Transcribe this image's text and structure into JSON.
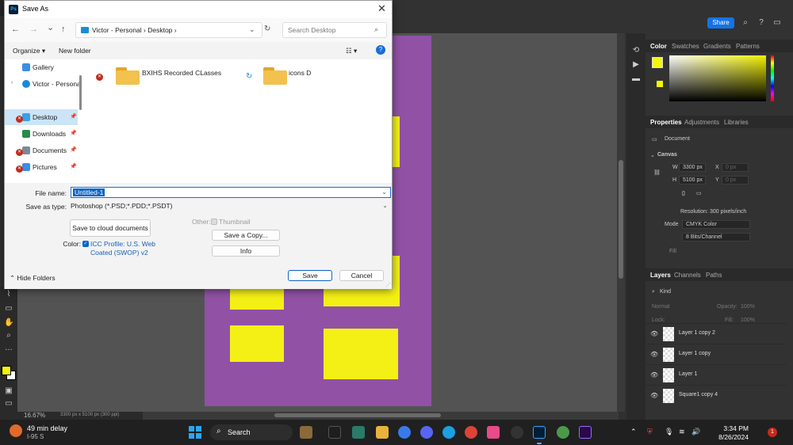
{
  "dialog": {
    "title": "Save As",
    "app_icon_text": "Ps",
    "close_glyph": "✕",
    "nav": {
      "back": "←",
      "forward": "→",
      "recent": "⌄",
      "up": "↑"
    },
    "address": {
      "path": "Victor - Personal  ›  Desktop  ›",
      "chevron": "⌄"
    },
    "refresh_glyph": "↻",
    "search": {
      "placeholder": "Search Desktop",
      "icon": "⌕"
    },
    "toolbar": {
      "organize": "Organize ▾",
      "new_folder": "New folder",
      "view_glyph": "☷ ▾",
      "help_glyph": "?"
    },
    "nav_pane": [
      {
        "label": "Gallery",
        "pinned": false,
        "selected": false,
        "icon_color": "#3a8ee6",
        "error": false
      },
      {
        "label": "Victor - Personal",
        "pinned": false,
        "selected": false,
        "icon_color": "#1a8bd9",
        "error": false
      },
      {
        "label": "Desktop",
        "pinned": true,
        "selected": true,
        "icon_color": "#3aa0e8",
        "error": true
      },
      {
        "label": "Downloads",
        "pinned": true,
        "selected": false,
        "icon_color": "#2a8a4a",
        "error": false
      },
      {
        "label": "Documents",
        "pinned": true,
        "selected": false,
        "icon_color": "#7a8a9a",
        "error": true
      },
      {
        "label": "Pictures",
        "pinned": true,
        "selected": false,
        "icon_color": "#3a8ee6",
        "error": true
      }
    ],
    "pin_glyph": "📌",
    "files": [
      {
        "name": "BXIHS Recorded CLasses",
        "status": "error"
      },
      {
        "name": "icons D",
        "status": "syncing"
      }
    ],
    "file_name": {
      "label": "File name:",
      "value": "Untitled-1"
    },
    "save_type": {
      "label": "Save as type:",
      "value": "Photoshop (*.PSD;*.PDD;*.PSDT)"
    },
    "save_cloud": "Save to cloud documents",
    "color": {
      "label": "Color:",
      "value_line1": "ICC Profile:  U.S. Web",
      "value_line2": "Coated (SWOP) v2"
    },
    "other": {
      "label": "Other:",
      "thumbnail": "Thumbnail"
    },
    "save_copy": "Save a Copy...",
    "info": "Info",
    "hide_folders": "Hide Folders",
    "save": "Save",
    "cancel": "Cancel"
  },
  "photoshop": {
    "share": "Share",
    "zoom": "16.67%",
    "doc_dims": "3300 px x 5100 px (300 ppi)",
    "color_tabs": [
      "Color",
      "Swatches",
      "Gradients",
      "Patterns"
    ],
    "prop_tabs": [
      "Properties",
      "Adjustments",
      "Libraries"
    ],
    "document_label": "Document",
    "canvas_label": "Canvas",
    "w_label": "W",
    "w_value": "3300 px",
    "h_label": "H",
    "h_value": "5100 px",
    "x_label": "X",
    "y_label": "Y",
    "x_value": "0 px",
    "y_value": "0 px",
    "resolution": "Resolution: 300 pixels/inch",
    "mode_label": "Mode",
    "mode_value": "CMYK Color",
    "bits_value": "8 Bits/Channel",
    "fill_label": "Fill",
    "layer_tabs": [
      "Layers",
      "Channels",
      "Paths"
    ],
    "kind_label": "Kind",
    "blend_mode": "Normal",
    "opacity_label": "Opacity:",
    "opacity_value": "100%",
    "lock_label": "Lock:",
    "fill_layer_label": "Fill:",
    "fill_layer_value": "100%",
    "layers": [
      "Layer 1 copy 2",
      "Layer 1 copy",
      "Layer 1",
      "Square1 copy 4"
    ]
  },
  "taskbar": {
    "weather_line1": "49 min delay",
    "weather_line2": "I-95 S",
    "search_label": "Search",
    "time": "3:34 PM",
    "date": "8/26/2024",
    "notif_count": "1"
  },
  "colors": {
    "artboard": "#9152a5",
    "square": "#f4f016",
    "accent": "#0a64c8"
  }
}
